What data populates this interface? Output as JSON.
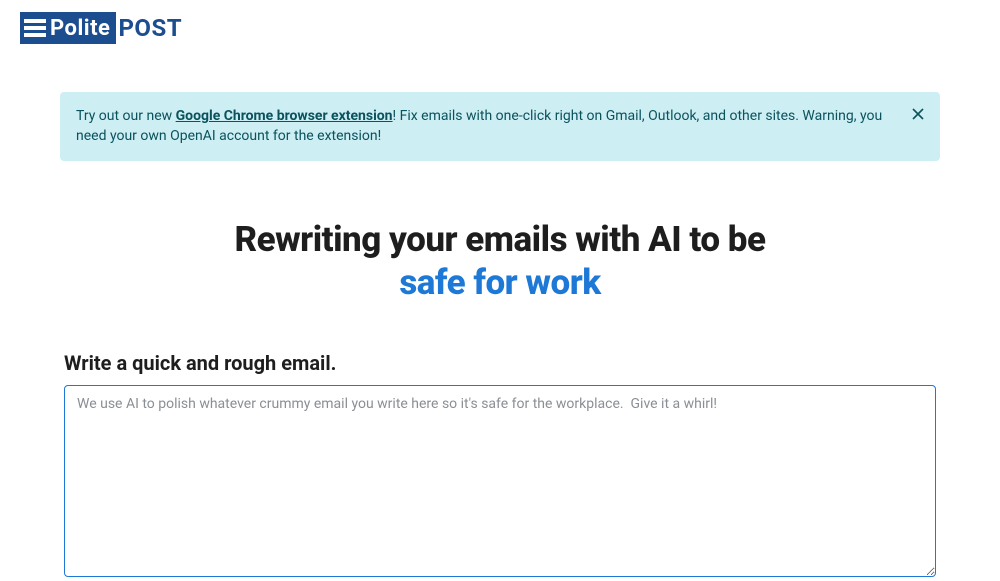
{
  "logo": {
    "polite": "Polite",
    "post": "POST"
  },
  "banner": {
    "prefix": "Try out our new ",
    "link": "Google Chrome browser extension",
    "suffix": "! Fix emails with one-click right on Gmail, Outlook, and other sites. Warning, you need your own OpenAI account for the extension!"
  },
  "heading": {
    "line1": "Rewriting your emails with AI to be",
    "line2": "safe for work"
  },
  "form": {
    "label": "Write a quick and rough email.",
    "placeholder": "We use AI to polish whatever crummy email you write here so it's safe for the workplace.  Give it a whirl!"
  }
}
